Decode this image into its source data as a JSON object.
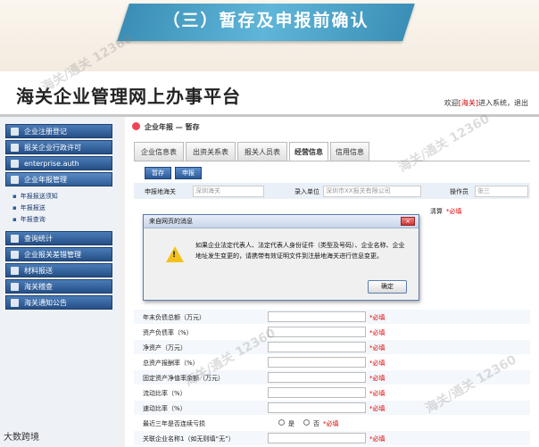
{
  "banner": {
    "title": "（三）暂存及申报前确认"
  },
  "portal": {
    "title": "海关企业管理网上办事平台",
    "welcome_prefix": "欢迎",
    "user": "[海关]",
    "welcome_suffix": "进入系统，",
    "logout": "退出"
  },
  "sidebar": {
    "items": [
      {
        "label": "企业注册登记"
      },
      {
        "label": "报关企业行政许可"
      },
      {
        "label": "enterprise.auth"
      },
      {
        "label": "企业年报管理"
      },
      {
        "label": "查询统计"
      },
      {
        "label": "企业报关差错管理"
      },
      {
        "label": "材料报送"
      },
      {
        "label": "海关稽查"
      },
      {
        "label": "海关通知公告"
      }
    ],
    "sub_items": [
      {
        "label": "年报报送须知"
      },
      {
        "label": "年报报送"
      },
      {
        "label": "年报查询"
      }
    ]
  },
  "main": {
    "heading": "企业年报 — 暂存",
    "tabs": [
      {
        "label": "企业信息表"
      },
      {
        "label": "出资关系表"
      },
      {
        "label": "报关人员表"
      },
      {
        "label": "经营信息"
      },
      {
        "label": "信用信息"
      }
    ],
    "buttons": {
      "save": "暂存",
      "submit": "申报"
    },
    "top_fields": {
      "customs_label": "申报地海关",
      "customs_value": "深圳海关",
      "entry_unit_label": "录入单位",
      "entry_unit_value": "深圳市XX报关有限公司",
      "operator_label": "操作员",
      "operator_value": "张三"
    },
    "clear_label": "清算",
    "required": "*必填",
    "rows": [
      {
        "label": "年末负债总额（万元）"
      },
      {
        "label": "资产负债率（%）"
      },
      {
        "label": "净资产（万元）"
      },
      {
        "label": "总资产报酬率（%）"
      },
      {
        "label": "固定资产净值率余额（万元）"
      },
      {
        "label": "流动比率（%）"
      },
      {
        "label": "速动比率（%）"
      },
      {
        "label": "最近三年是否连续亏损"
      },
      {
        "label": "关联企业名称1（如无则填“无”）"
      }
    ],
    "radio_yes": "是",
    "radio_no": "否"
  },
  "modal": {
    "title": "来自网页的消息",
    "message": "如果企业法定代表人、法定代表人身份证件（类型及号码）、企业名称、企业地址发生变更的，请携带有效证明文件到注册地海关进行信息变更。",
    "ok": "确定",
    "close": "×"
  },
  "watermark": {
    "text": "海关/通关 12360",
    "footer": "大数跨境"
  },
  "colors": {
    "sidebar_blue": "#2b5a98",
    "banner": "#3b8fb6",
    "required_red": "#d00"
  }
}
